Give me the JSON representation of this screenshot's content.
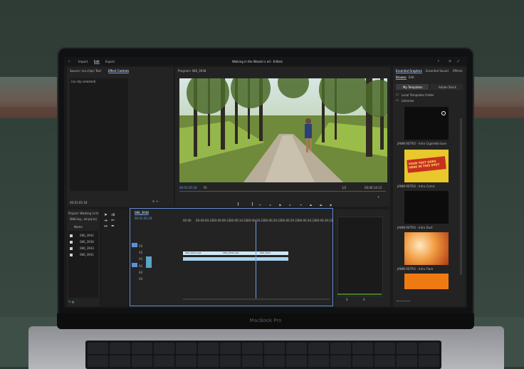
{
  "app": {
    "menu": [
      "Import",
      "Edit",
      "Export"
    ],
    "window_title": "Walking in the Woods is ed - Edited"
  },
  "source_panel": {
    "tabs": [
      "Source: (no clips)",
      "Text",
      "Effect Controls"
    ],
    "subtitle": "(no clip selected)",
    "timecode": "00:01:05:18"
  },
  "program": {
    "tab": "Program: 086_3938",
    "timecode_left": "00:01:05:18",
    "zoom": "Fit",
    "quality": "1/2",
    "timecode_right": "00:00:14:12"
  },
  "essential_graphics": {
    "title": "Essential Graphics",
    "tabs": [
      "Essential Sound",
      "Effects"
    ],
    "subtabs": [
      "Browse",
      "Edit"
    ],
    "my_templates": "My Templates",
    "adobe_stock": "Adobe Stock",
    "checkboxes": [
      "Local Templates Folder",
      "Libraries"
    ],
    "templates": [
      {
        "label": "JANIN RETRO - Intro Cigarette burn",
        "color": "#0d0d0e"
      },
      {
        "label": "JANIN RETRO - Intro Comic",
        "color": "#e8c82a"
      },
      {
        "label": "JANIN RETRO - Intro Dust",
        "color": "#0c0c0d"
      },
      {
        "label": "JANIN RETRO - Intro Flare",
        "color": "#f09a40"
      },
      {
        "label": "",
        "color": "#f07a12"
      }
    ],
    "comic_text": "YOUR TEXT GOES HERE IN THIS SPOT"
  },
  "project": {
    "title": "Project: Walking in th",
    "search": "Walking...ed.prproj",
    "column": "Name",
    "items": [
      "086_3942",
      "086_3938",
      "086_3943",
      "086_3941"
    ]
  },
  "timeline": {
    "tab": "086_3938",
    "timecode": "00:01:05:18",
    "ruler": [
      "00:00",
      "00:00:04:23",
      "00:00:09:23",
      "00:00:14:23",
      "00:00:19:23",
      "00:00:24:23",
      "00:00:29:23",
      "00:00:34:23",
      "00:00:39:23"
    ],
    "tracks": [
      "V3",
      "V2",
      "V1",
      "A1",
      "A2",
      "A3"
    ],
    "clips": [
      {
        "label": "086_3942.mp4",
        "track": "V1"
      },
      {
        "label": "086_3938.mp4",
        "track": "V1"
      },
      {
        "label": "086_3943",
        "track": "V1"
      }
    ]
  },
  "colors": {
    "accent": "#5e8fd6",
    "clip": "#a9d4ee",
    "panel": "#232324",
    "panel_dark": "#1a1a1b"
  },
  "laptop_brand": "MacBook Pro"
}
